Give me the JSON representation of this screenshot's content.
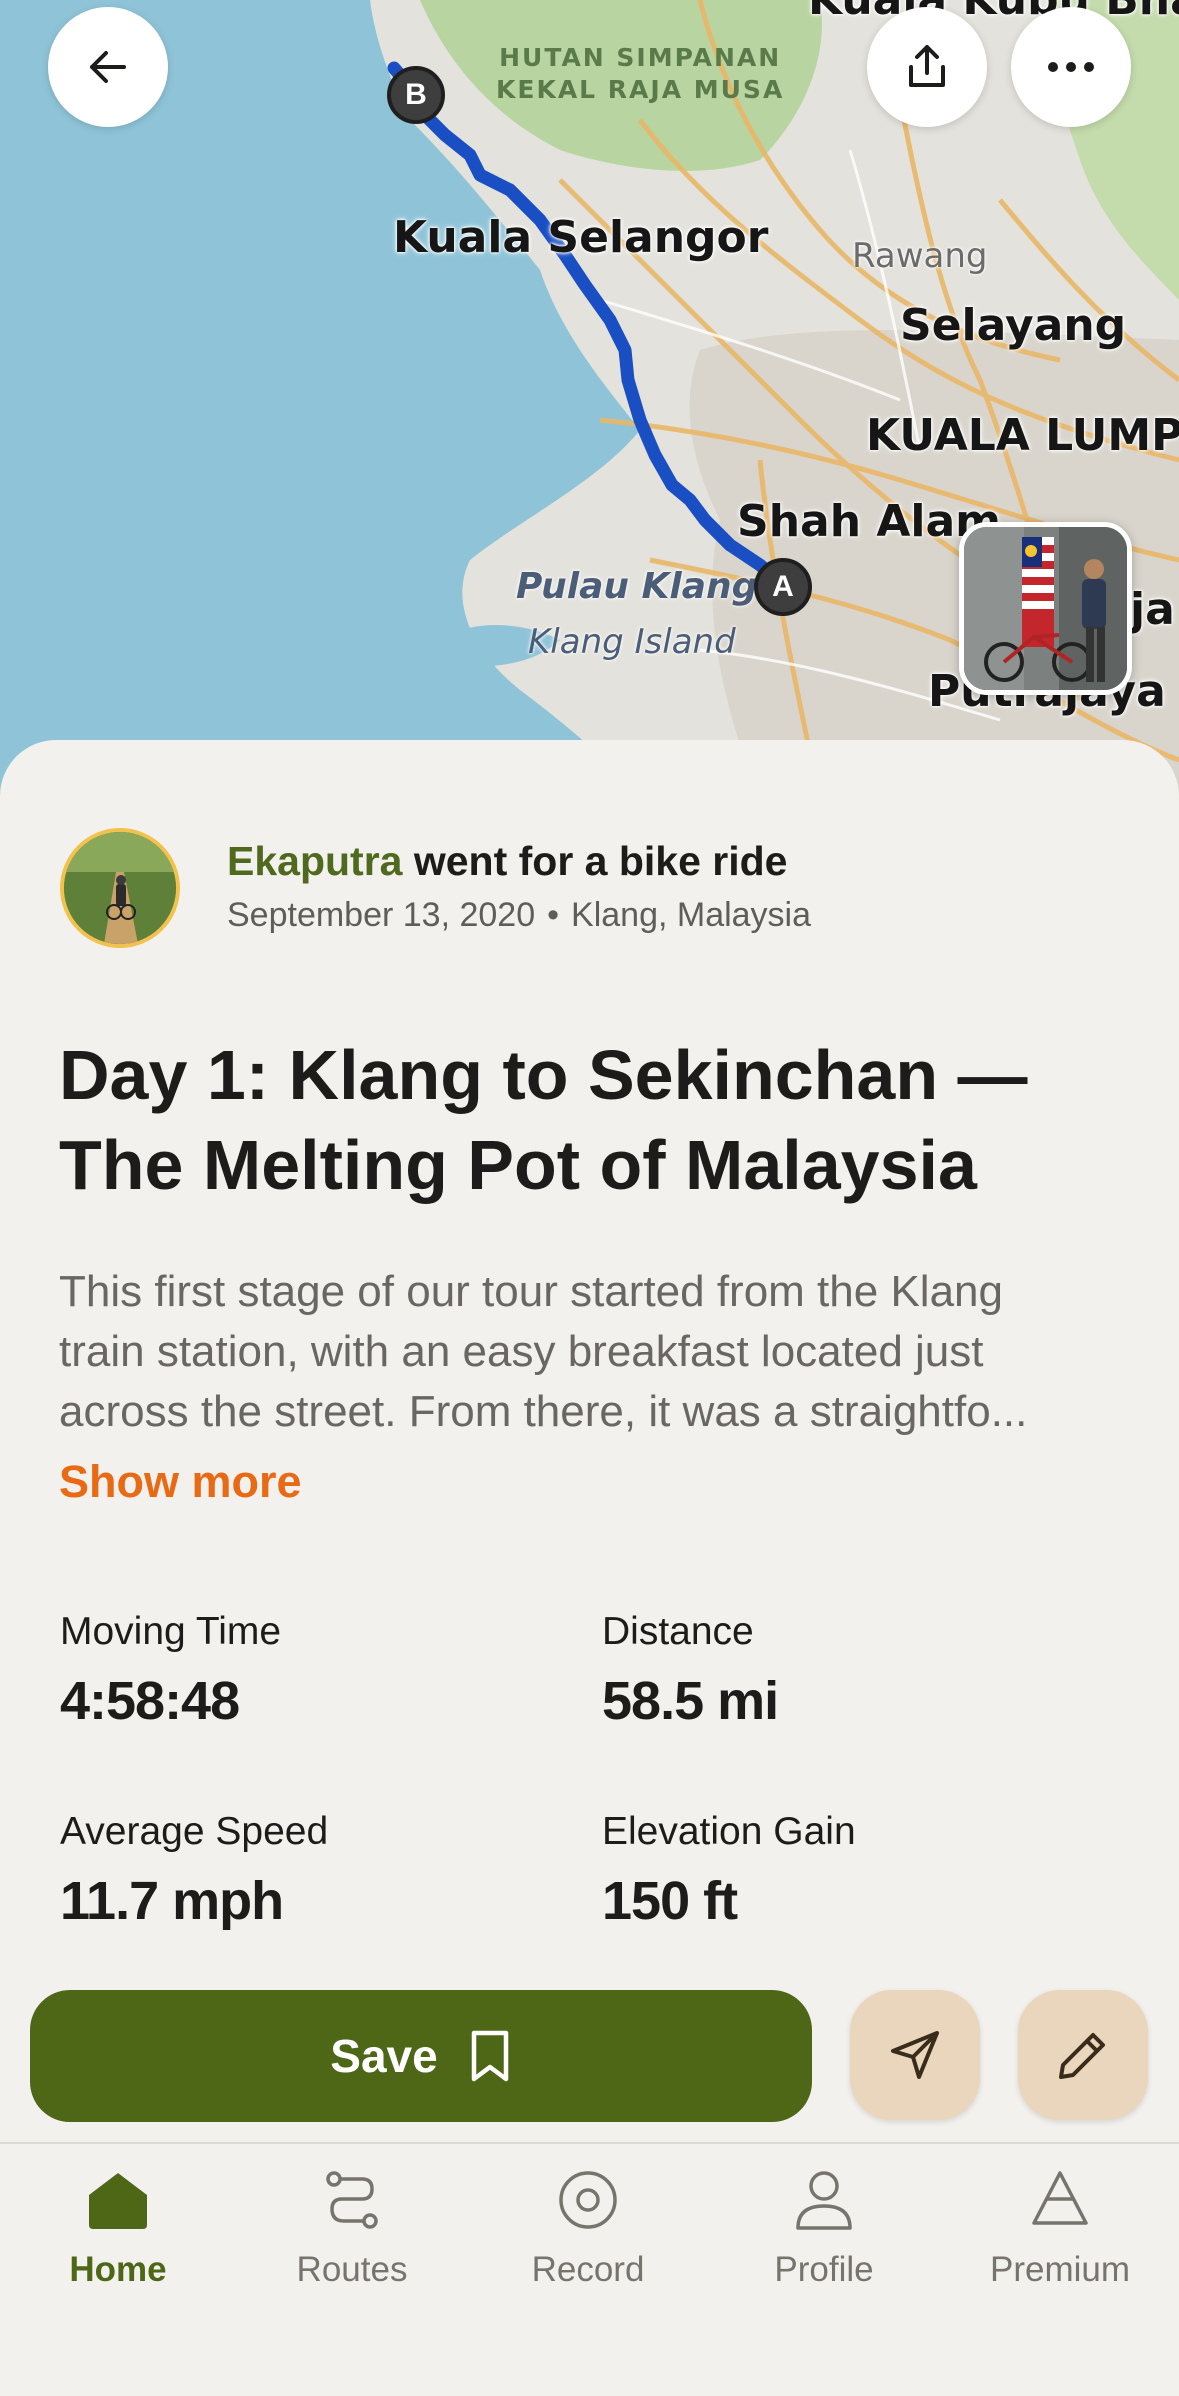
{
  "map": {
    "labels": {
      "kuala_kubu": "Kuala Kubu Bharu",
      "forest_line1": "HUTAN SIMPANAN",
      "forest_line2": "KEKAL RAJA MUSA",
      "kuala_selangor": "Kuala Selangor",
      "rawang": "Rawang",
      "selayang": "Selayang",
      "kuala_lumpur": "KUALA LUMPUR",
      "shah_alam": "Shah Alam",
      "pulau_klang": "Pulau Klang",
      "klang_island": "Klang Island",
      "putrajaya": "Putrajaya",
      "cyberjaya_fragment": "ja"
    },
    "markers": {
      "start": "A",
      "end": "B"
    },
    "route_color": "#1a4fc4"
  },
  "top_buttons": {
    "back_icon": "arrow-left-icon",
    "share_icon": "share-icon",
    "more_icon": "more-horizontal-icon"
  },
  "activity": {
    "user": "Ekaputra",
    "action": " went for a bike ride",
    "date": "September 13, 2020",
    "separator": "•",
    "location": "Klang, Malaysia",
    "title": "Day 1: Klang to Sekinchan — The Melting Pot of Malaysia",
    "description_lines": [
      "This first stage of our tour started from the Klang",
      "train station, with an easy breakfast located just",
      "across the street. From there, it was a straightfo..."
    ],
    "show_more": "Show more"
  },
  "stats": {
    "moving_time": {
      "label": "Moving Time",
      "value": "4:58:48"
    },
    "distance": {
      "label": "Distance",
      "value": "58.5 mi"
    },
    "avg_speed": {
      "label": "Average Speed",
      "value": "11.7 mph"
    },
    "elevation": {
      "label": "Elevation Gain",
      "value": "150 ft"
    }
  },
  "actions": {
    "save_label": "Save",
    "save_icon": "bookmark-icon",
    "send_icon": "send-icon",
    "edit_icon": "pencil-icon"
  },
  "tabs": [
    {
      "label": "Home",
      "icon": "home-icon",
      "active": true
    },
    {
      "label": "Routes",
      "icon": "routes-icon",
      "active": false
    },
    {
      "label": "Record",
      "icon": "record-icon",
      "active": false
    },
    {
      "label": "Profile",
      "icon": "profile-icon",
      "active": false
    },
    {
      "label": "Premium",
      "icon": "premium-icon",
      "active": false
    }
  ],
  "colors": {
    "accent_green": "#4e6717",
    "accent_orange": "#e86a14",
    "button_tan": "#e9d6bc"
  }
}
